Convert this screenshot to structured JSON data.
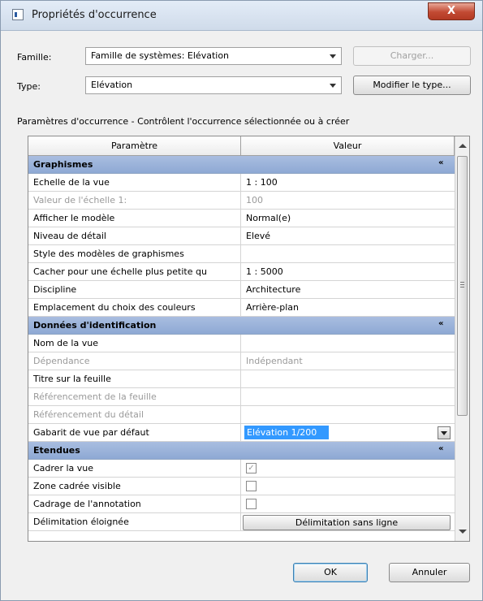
{
  "window": {
    "title": "Propriétés d'occurrence",
    "close_label": "X"
  },
  "famille": {
    "label": "Famille:",
    "value": "Famille de systèmes: Elévation",
    "charger_label": "Charger..."
  },
  "type": {
    "label": "Type:",
    "value": "Elévation",
    "modifier_label": "Modifier le type..."
  },
  "description": "Paramètres d'occurrence - Contrôlent l'occurrence sélectionnée ou à créer",
  "grid": {
    "col_param": "Paramètre",
    "col_value": "Valeur",
    "sections": [
      {
        "title": "Graphismes",
        "chevron": "«",
        "rows": [
          {
            "param": "Echelle de la vue",
            "value": "1 : 100"
          },
          {
            "param": "Valeur de l'échelle   1:",
            "value": "100"
          },
          {
            "param": "Afficher le modèle",
            "value": "Normal(e)"
          },
          {
            "param": "Niveau de détail",
            "value": "Elevé"
          },
          {
            "param": "Style des modèles de graphismes",
            "value": ""
          },
          {
            "param": "Cacher pour une échelle plus petite qu",
            "value": "1 : 5000"
          },
          {
            "param": "Discipline",
            "value": "Architecture"
          },
          {
            "param": "Emplacement du choix des couleurs",
            "value": "Arrière-plan"
          }
        ]
      },
      {
        "title": "Données d'identification",
        "chevron": "«",
        "rows": [
          {
            "param": "Nom de la vue",
            "value": ""
          },
          {
            "param": "Dépendance",
            "value": "Indépendant"
          },
          {
            "param": "Titre sur la feuille",
            "value": ""
          },
          {
            "param": "Référencement de la feuille",
            "value": ""
          },
          {
            "param": "Référencement du détail",
            "value": ""
          },
          {
            "param": "Gabarit de vue par défaut",
            "value": "Elévation 1/200"
          }
        ]
      },
      {
        "title": "Etendues",
        "chevron": "«",
        "rows": [
          {
            "param": "Cadrer la vue",
            "checked": true
          },
          {
            "param": "Zone cadrée visible",
            "checked": false
          },
          {
            "param": "Cadrage de l'annotation",
            "checked": false
          },
          {
            "param": "Délimitation éloignée",
            "value": "Délimitation sans ligne"
          }
        ]
      }
    ]
  },
  "buttons": {
    "ok": "OK",
    "cancel": "Annuler"
  }
}
